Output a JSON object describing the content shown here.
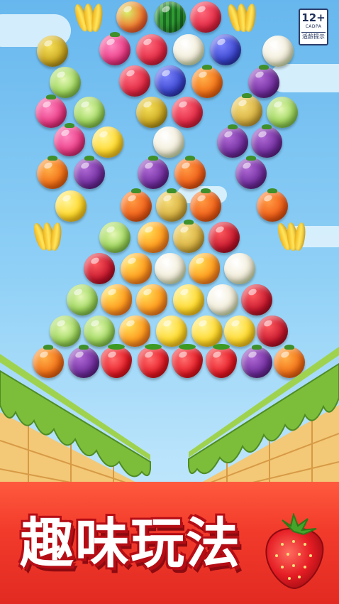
{
  "age_rating": {
    "age": "12+",
    "org": "CADPA",
    "tip": "适龄提示"
  },
  "banner": {
    "title": "趣味玩法",
    "icon": "strawberry-icon"
  },
  "board": {
    "fruits": [
      {
        "type": "banana",
        "col": 126,
        "row": 24
      },
      {
        "type": "apple",
        "col": 186,
        "row": 24
      },
      {
        "type": "watermelon",
        "col": 240,
        "row": 24
      },
      {
        "type": "raspberry",
        "col": 290,
        "row": 24
      },
      {
        "type": "banana",
        "col": 342,
        "row": 24
      },
      {
        "type": "durian",
        "col": 74,
        "row": 72
      },
      {
        "type": "dragon",
        "col": 162,
        "row": 70
      },
      {
        "type": "raspberry",
        "col": 214,
        "row": 70
      },
      {
        "type": "cauliflower",
        "col": 266,
        "row": 70
      },
      {
        "type": "blueberry",
        "col": 318,
        "row": 70
      },
      {
        "type": "cauliflower",
        "col": 392,
        "row": 72
      },
      {
        "type": "cabbage",
        "col": 92,
        "row": 116
      },
      {
        "type": "raspberry",
        "col": 190,
        "row": 114
      },
      {
        "type": "blueberry",
        "col": 240,
        "row": 114
      },
      {
        "type": "orange",
        "col": 292,
        "row": 116
      },
      {
        "type": "mangosteen",
        "col": 372,
        "row": 116
      },
      {
        "type": "dragon",
        "col": 72,
        "row": 158
      },
      {
        "type": "cabbage",
        "col": 126,
        "row": 158
      },
      {
        "type": "durian",
        "col": 214,
        "row": 158
      },
      {
        "type": "raspberry",
        "col": 264,
        "row": 158
      },
      {
        "type": "pear",
        "col": 348,
        "row": 156
      },
      {
        "type": "cabbage",
        "col": 398,
        "row": 158
      },
      {
        "type": "dragon",
        "col": 98,
        "row": 198
      },
      {
        "type": "lemon",
        "col": 152,
        "row": 200
      },
      {
        "type": "cauliflower",
        "col": 238,
        "row": 200
      },
      {
        "type": "mangosteen",
        "col": 328,
        "row": 200
      },
      {
        "type": "mangosteen",
        "col": 376,
        "row": 200
      },
      {
        "type": "orange",
        "col": 74,
        "row": 244
      },
      {
        "type": "mangosteen",
        "col": 126,
        "row": 244
      },
      {
        "type": "mangosteen",
        "col": 216,
        "row": 244
      },
      {
        "type": "persimmon",
        "col": 268,
        "row": 244
      },
      {
        "type": "mangosteen",
        "col": 354,
        "row": 244
      },
      {
        "type": "lemon",
        "col": 100,
        "row": 290
      },
      {
        "type": "persimmon",
        "col": 192,
        "row": 290
      },
      {
        "type": "pear",
        "col": 242,
        "row": 290
      },
      {
        "type": "persimmon",
        "col": 290,
        "row": 290
      },
      {
        "type": "persimmon",
        "col": 384,
        "row": 290
      },
      {
        "type": "banana",
        "col": 68,
        "row": 332
      },
      {
        "type": "cabbage",
        "col": 162,
        "row": 334
      },
      {
        "type": "mango",
        "col": 216,
        "row": 334
      },
      {
        "type": "pear",
        "col": 266,
        "row": 334
      },
      {
        "type": "lychee",
        "col": 316,
        "row": 334
      },
      {
        "type": "banana",
        "col": 412,
        "row": 332
      },
      {
        "type": "lychee",
        "col": 140,
        "row": 378
      },
      {
        "type": "mango",
        "col": 192,
        "row": 378
      },
      {
        "type": "cauliflower",
        "col": 240,
        "row": 378
      },
      {
        "type": "mango",
        "col": 288,
        "row": 378
      },
      {
        "type": "cauliflower",
        "col": 338,
        "row": 378
      },
      {
        "type": "cabbage",
        "col": 116,
        "row": 422
      },
      {
        "type": "mango",
        "col": 164,
        "row": 422
      },
      {
        "type": "mango",
        "col": 214,
        "row": 422
      },
      {
        "type": "lemon",
        "col": 266,
        "row": 422
      },
      {
        "type": "cauliflower",
        "col": 314,
        "row": 422
      },
      {
        "type": "lychee",
        "col": 362,
        "row": 422
      },
      {
        "type": "cabbage",
        "col": 92,
        "row": 466
      },
      {
        "type": "cabbage",
        "col": 140,
        "row": 466
      },
      {
        "type": "mango",
        "col": 190,
        "row": 466
      },
      {
        "type": "lemon",
        "col": 242,
        "row": 466
      },
      {
        "type": "lemon",
        "col": 292,
        "row": 466
      },
      {
        "type": "lemon",
        "col": 338,
        "row": 466
      },
      {
        "type": "lychee",
        "col": 384,
        "row": 466
      },
      {
        "type": "orange",
        "col": 68,
        "row": 510
      },
      {
        "type": "mangosteen",
        "col": 118,
        "row": 510
      },
      {
        "type": "strawberry",
        "col": 164,
        "row": 510
      },
      {
        "type": "strawberry",
        "col": 216,
        "row": 510
      },
      {
        "type": "strawberry",
        "col": 264,
        "row": 510
      },
      {
        "type": "strawberry",
        "col": 312,
        "row": 510
      },
      {
        "type": "mangosteen",
        "col": 362,
        "row": 510
      },
      {
        "type": "orange",
        "col": 408,
        "row": 510
      }
    ]
  }
}
